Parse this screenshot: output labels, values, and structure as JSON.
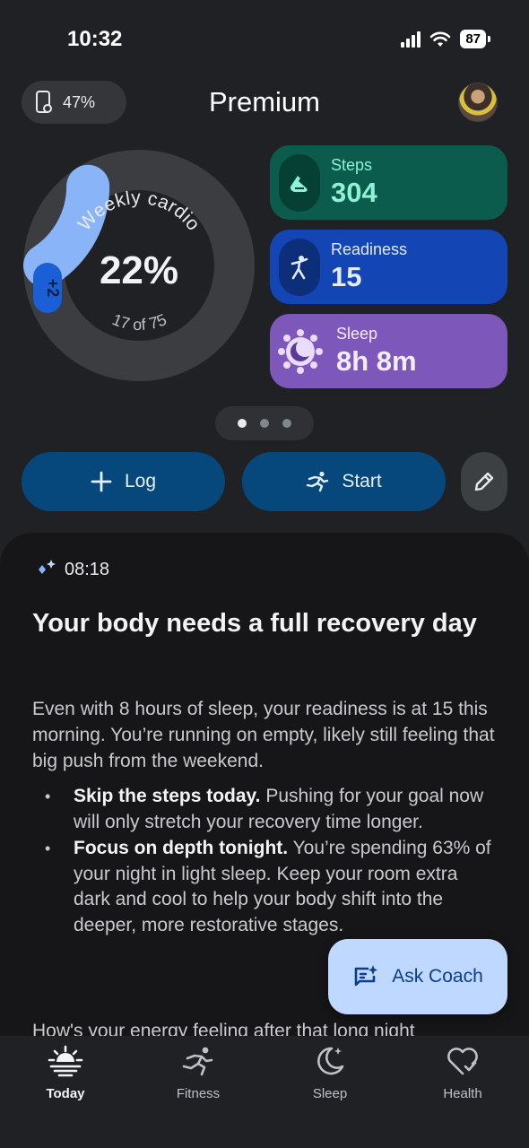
{
  "status_bar": {
    "time": "10:32",
    "battery": "87"
  },
  "header": {
    "device_battery": "47%",
    "title": "Premium"
  },
  "ring": {
    "label": "Weekly cardio",
    "percent": "22%",
    "progress": "17 of 75",
    "bonus": "+2",
    "fraction": 0.227
  },
  "metrics": [
    {
      "label": "Steps",
      "value": "304",
      "icon": "shoe-icon"
    },
    {
      "label": "Readiness",
      "value": "15",
      "icon": "readiness-figure-icon"
    },
    {
      "label": "Sleep",
      "value": "8h 8m",
      "icon": "moon-sleep-icon"
    }
  ],
  "pager": {
    "pages": 3,
    "active": 0
  },
  "actions": {
    "log_label": "Log",
    "start_label": "Start"
  },
  "insight": {
    "time": "08:18",
    "title": "Your body needs a full recovery day",
    "body": "Even with 8 hours of sleep, your readiness is at 15 this morning. You’re running on empty, likely still feeling that big push from the weekend.",
    "bullets": [
      {
        "bold": "Skip the steps today.",
        "text": " Pushing for your goal now will only stretch your recovery time longer."
      },
      {
        "bold": "Focus on depth tonight.",
        "text": " You’re spending 63% of your night in light sleep. Keep your room extra dark and cool to help your body shift into the deeper, more restorative stages."
      }
    ],
    "trailing": "How's your energy feeling after that long night"
  },
  "coach": {
    "label": "Ask Coach"
  },
  "nav": [
    {
      "label": "Today",
      "icon": "sunrise-icon"
    },
    {
      "label": "Fitness",
      "icon": "runner-icon"
    },
    {
      "label": "Sleep",
      "icon": "moon-icon"
    },
    {
      "label": "Health",
      "icon": "heart-check-icon"
    }
  ],
  "colors": {
    "steps_card": "#0b5c4c",
    "readiness_card": "#1346b4",
    "sleep_card": "#7d57b9",
    "ring_progress": "#8ab4f8",
    "coach_button": "#bfd8ff"
  }
}
